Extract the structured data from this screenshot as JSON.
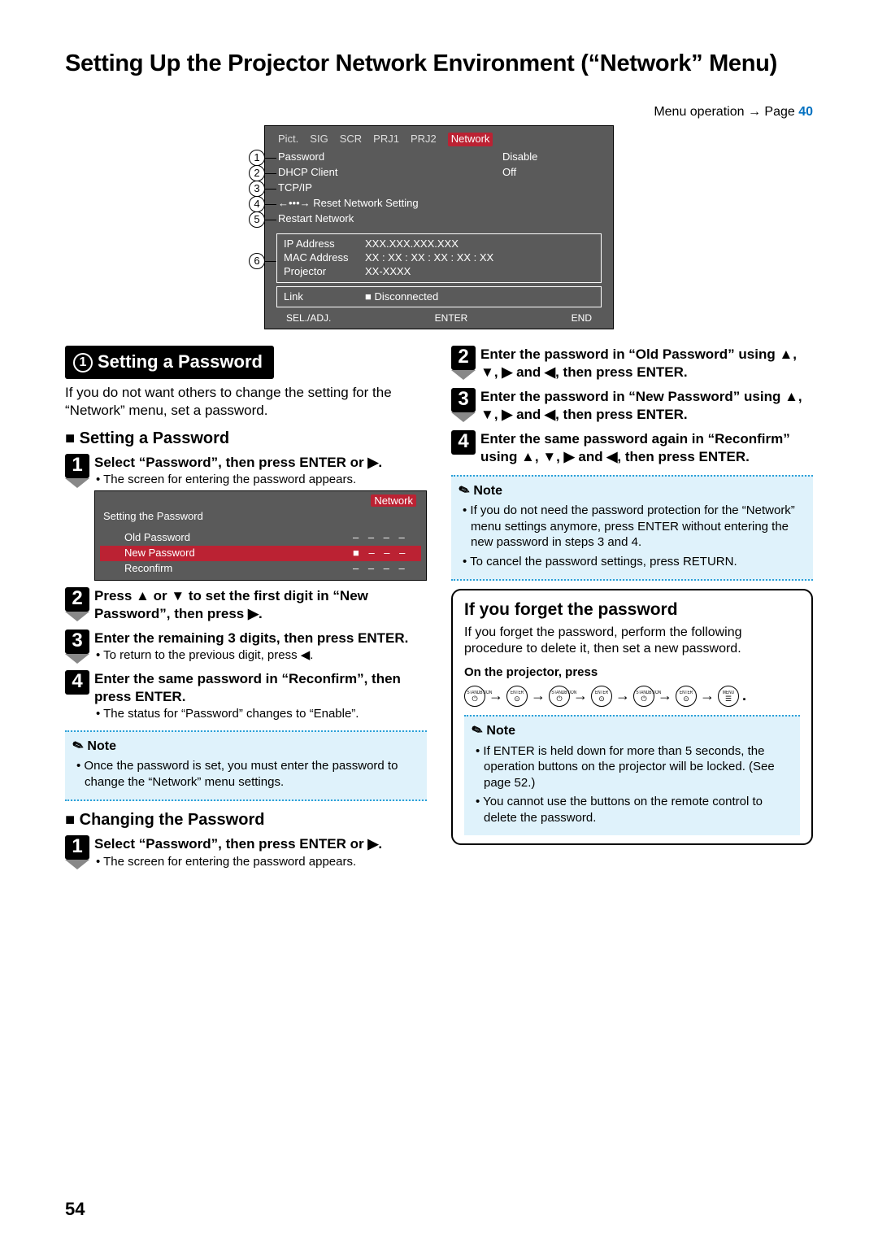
{
  "page_title": "Setting Up the Projector Network Environment (“Network” Menu)",
  "menu_op_prefix": "Menu operation → Page ",
  "menu_op_page": "40",
  "menu": {
    "tabs": [
      "Pict.",
      "SIG",
      "SCR",
      "PRJ1",
      "PRJ2",
      "Network"
    ],
    "items": [
      {
        "num": "1",
        "label": "Password",
        "val": "Disable"
      },
      {
        "num": "2",
        "label": "DHCP Client",
        "val": "Off"
      },
      {
        "num": "3",
        "label": "TCP/IP",
        "val": ""
      },
      {
        "num": "4",
        "label": "←•••→ Reset Network Setting",
        "val": ""
      },
      {
        "num": "5",
        "label": "Restart Network",
        "val": ""
      }
    ],
    "info_num": "6",
    "info": [
      {
        "l": "IP Address",
        "v": "XXX.XXX.XXX.XXX"
      },
      {
        "l": "MAC Address",
        "v": "XX : XX : XX : XX : XX : XX"
      },
      {
        "l": "Projector",
        "v": "XX-XXXX"
      }
    ],
    "link_l": "Link",
    "link_v": "■  Disconnected",
    "footer": [
      "SEL./ADJ.",
      "ENTER",
      "END"
    ]
  },
  "section1": {
    "num": "1",
    "title": "Setting a Password",
    "intro": "If you do not want others to change the setting for the “Network” menu, set a password."
  },
  "setpw": {
    "heading": "Setting a Password",
    "s1": {
      "n": "1",
      "t": "Select “Password”, then press ENTER or ▶.",
      "sub": "• The screen for entering the password appears."
    },
    "panel": {
      "tab": "Network",
      "title": "Setting the Password",
      "rows": [
        {
          "l": "Old Password",
          "v": "– – – –"
        },
        {
          "l": "New Password",
          "v": "■ – – –",
          "hl": true
        },
        {
          "l": "Reconfirm",
          "v": "– – – –"
        }
      ]
    },
    "s2": {
      "n": "2",
      "t": "Press ▲ or ▼ to set the first digit in “New Password”, then press ▶."
    },
    "s3": {
      "n": "3",
      "t": "Enter the remaining 3 digits, then press ENTER.",
      "sub": "• To return to the previous digit, press ◀."
    },
    "s4": {
      "n": "4",
      "t": "Enter the same password in “Reconfirm”, then press ENTER.",
      "sub": "• The status for “Password” changes to “Enable”."
    }
  },
  "note1": {
    "label": "Note",
    "items": [
      "Once the password is set, you must enter the password to change the “Network” menu settings."
    ]
  },
  "changepw": {
    "heading": "Changing the Password",
    "s1": {
      "n": "1",
      "t": "Select “Password”, then press ENTER or ▶.",
      "sub": "• The screen for entering the password appears."
    }
  },
  "right_steps": {
    "s2": {
      "n": "2",
      "t": "Enter the password in “Old Password” using ▲, ▼, ▶ and ◀, then press ENTER."
    },
    "s3": {
      "n": "3",
      "t": "Enter the password in “New Password” using ▲, ▼, ▶ and ◀, then press ENTER."
    },
    "s4": {
      "n": "4",
      "t": "Enter the same password again in “Reconfirm” using ▲, ▼, ▶ and ◀, then press ENTER."
    }
  },
  "note2": {
    "label": "Note",
    "items": [
      "If you do not need the password protection for the “Network” menu settings anymore, press ENTER without entering the new password in steps 3 and 4.",
      "To cancel the password settings, press RETURN."
    ]
  },
  "forget": {
    "title": "If you forget the password",
    "body": "If you forget the password, perform the following procedure to delete it, then set a new password.",
    "on_proj": "On the projector, press",
    "keys": [
      "STANDBY/ON",
      "ENTER",
      "STANDBY/ON",
      "ENTER",
      "STANDBY/ON",
      "ENTER",
      "MENU"
    ],
    "note_label": "Note",
    "note_items": [
      "If ENTER is held down for more than 5 seconds, the operation buttons on the projector will be locked. (See page 52.)",
      "You cannot use the buttons on the remote control to delete the password."
    ]
  },
  "page_number": "54"
}
